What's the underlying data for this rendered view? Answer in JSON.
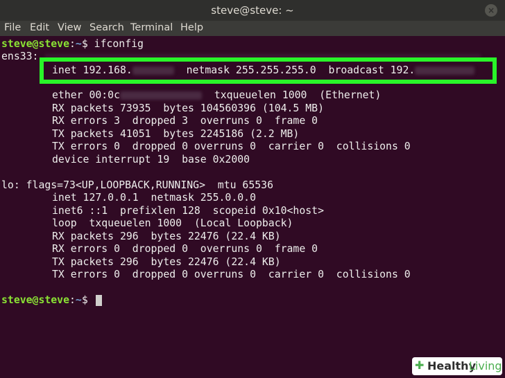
{
  "window": {
    "title": "steve@steve: ~",
    "close": "×"
  },
  "menu": [
    "File",
    "Edit",
    "View",
    "Search",
    "Terminal",
    "Help"
  ],
  "prompt": {
    "user": "steve@steve",
    "sep": ":",
    "path": "~",
    "sign": "$ "
  },
  "command": "ifconfig",
  "ens33": {
    "header": "ens33: ",
    "inet_prefix": "inet 192.168.",
    "netmask": "netmask 255.255.255.0",
    "broadcast_prefix": "broadcast 192.",
    "ether_prefix": "ether 00:0c",
    "txqueuelen": "txqueuelen 1000  (Ethernet)",
    "rx_packets": "RX packets 73935  bytes 104560396 (104.5 MB)",
    "rx_errors": "RX errors 3  dropped 3  overruns 0  frame 0",
    "tx_packets": "TX packets 41051  bytes 2245186 (2.2 MB)",
    "tx_errors": "TX errors 0  dropped 0 overruns 0  carrier 0  collisions 0",
    "device": "device interrupt 19  base 0x2000"
  },
  "lo": {
    "header": "lo: flags=73<UP,LOOPBACK,RUNNING>  mtu 65536",
    "inet": "inet 127.0.0.1  netmask 255.0.0.0",
    "inet6": "inet6 ::1  prefixlen 128  scopeid 0x10<host>",
    "loop": "loop  txqueuelen 1000  (Local Loopback)",
    "rx_packets": "RX packets 296  bytes 22476 (22.4 KB)",
    "rx_errors": "RX errors 0  dropped 0  overruns 0  frame 0",
    "tx_packets": "TX packets 296  bytes 22476 (22.4 KB)",
    "tx_errors": "TX errors 0  dropped 0 overruns 0  carrier 0  collisions 0"
  },
  "watermark": {
    "mark": "✚",
    "word1": "Healthy",
    "word2": "Living"
  }
}
